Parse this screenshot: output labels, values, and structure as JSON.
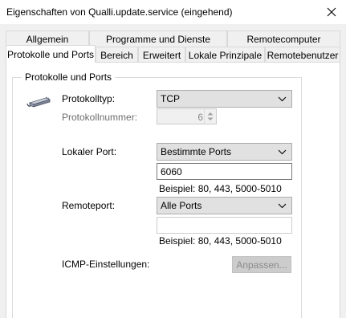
{
  "window": {
    "title": "Eigenschaften von Qualli.update.service (eingehend)",
    "close_icon": "close-icon"
  },
  "tabs": {
    "row1": [
      {
        "label": "Allgemein"
      },
      {
        "label": "Programme und Dienste"
      },
      {
        "label": "Remotecomputer"
      }
    ],
    "row2": [
      {
        "label": "Protokolle und Ports",
        "selected": true
      },
      {
        "label": "Bereich"
      },
      {
        "label": "Erweitert"
      },
      {
        "label": "Lokale Prinzipale"
      },
      {
        "label": "Remotebenutzer"
      }
    ]
  },
  "group": {
    "title": "Protokolle und Ports",
    "icon": "network-cable-icon",
    "protocol_type_label": "Protokolltyp:",
    "protocol_type_value": "TCP",
    "protocol_number_label": "Protokollnummer:",
    "protocol_number_value": "6",
    "local_port_label": "Lokaler Port:",
    "local_port_select": "Bestimmte Ports",
    "local_port_value": "6060",
    "local_port_example": "Beispiel: 80, 443, 5000-5010",
    "remote_port_label": "Remoteport:",
    "remote_port_select": "Alle Ports",
    "remote_port_value": "",
    "remote_port_example": "Beispiel: 80, 443, 5000-5010",
    "icmp_label": "ICMP-Einstellungen:",
    "icmp_button": "Anpassen..."
  }
}
